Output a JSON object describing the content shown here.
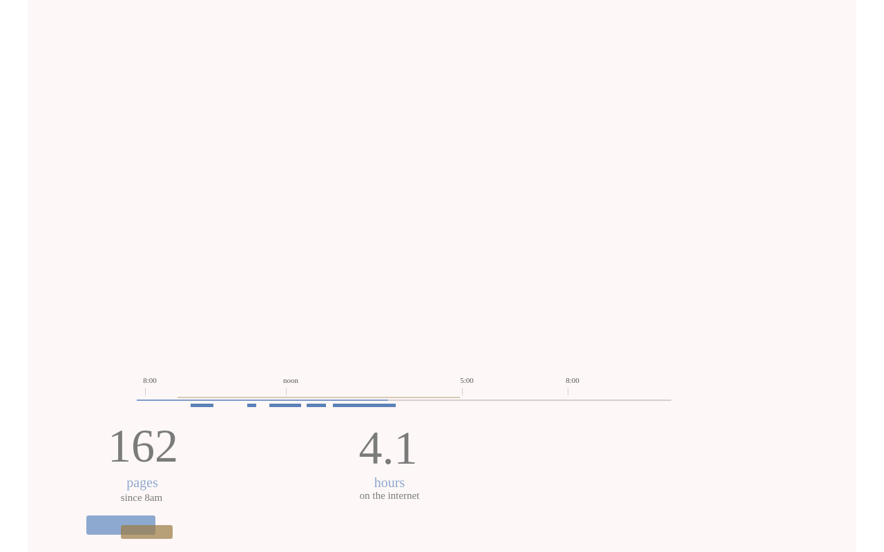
{
  "timeline": {
    "ticks": [
      {
        "label": "8:00"
      },
      {
        "label": "noon"
      },
      {
        "label": "5:00"
      },
      {
        "label": "8:00"
      }
    ]
  },
  "stats": {
    "pages": {
      "value": "162",
      "unit": "pages",
      "caption": "since 8am"
    },
    "hours": {
      "value": "4.1",
      "unit": "hours",
      "caption": "on the internet"
    }
  },
  "colors": {
    "background": "#fdf8f7",
    "primary": "#5b81b8",
    "secondary": "#b9a27a",
    "muted_text": "#7b7b7b",
    "unit_text": "#8fa8cf"
  },
  "legend": {
    "primary_swatch": "primary",
    "secondary_swatch": "secondary"
  }
}
